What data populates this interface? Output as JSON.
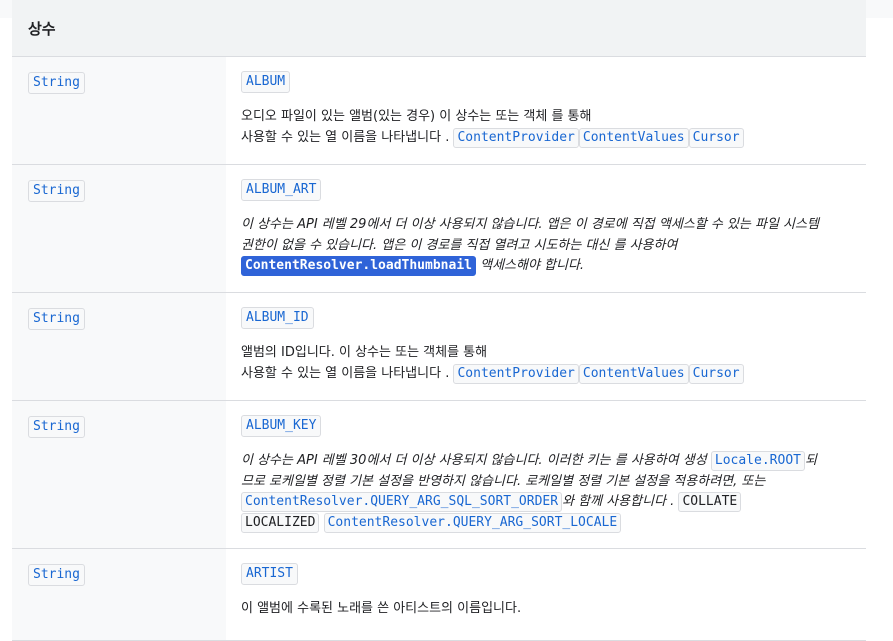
{
  "section_title": "상수",
  "rows": [
    {
      "type": "String",
      "name": "ALBUM",
      "line1": "오디오 파일이 있는 앨범(있는 경우) 이 상수는 또는 객체 를 통해",
      "line2_text": "사용할 수 있는 열 이름을 나타냅니다 .",
      "links": [
        "ContentProvider",
        "ContentValues",
        "Cursor"
      ]
    },
    {
      "type": "String",
      "name": "ALBUM_ART",
      "line1": "이 상수는 API 레벨 29에서 더 이상 사용되지 않습니다. 앱은 이 경로에 직접 액세스할 수 있는 파일 시스템",
      "line2": "권한이 없을 수 있습니다. 앱은 이 경로를 직접 열려고 시도하는 대신 를 사용하여",
      "code": "ContentResolver.loadThumbnail",
      "line3_text": "액세스해야 합니다."
    },
    {
      "type": "String",
      "name": "ALBUM_ID",
      "line1": "앨범의 ID입니다. 이 상수는 또는 객체를 통해",
      "line2_text": "사용할 수 있는 열 이름을 나타냅니다 .",
      "links": [
        "ContentProvider",
        "ContentValues",
        "Cursor"
      ]
    },
    {
      "type": "String",
      "name": "ALBUM_KEY",
      "line1_text": "이 상수는 API 레벨 30에서 더 이상 사용되지 않습니다. 이러한 키는 를 사용하여 생성",
      "line1_code": "Locale.ROOT",
      "line1_tail": "되",
      "line2": "므로 로케일별 정렬 기본 설정을 반영하지 않습니다. 로케일별 정렬 기본 설정을 적용하려면, 또는",
      "line3_code": "ContentResolver.QUERY_ARG_SQL_SORT_ORDER",
      "line3_text": "와 함께 사용합니다 .",
      "line3_code2": "COLLATE",
      "line4_code": "LOCALIZED",
      "line4_code2": "ContentResolver.QUERY_ARG_SORT_LOCALE"
    },
    {
      "type": "String",
      "name": "ARTIST",
      "line1": "이 앨범에 수록된 노래를 쓴 아티스트의 이름입니다."
    }
  ]
}
